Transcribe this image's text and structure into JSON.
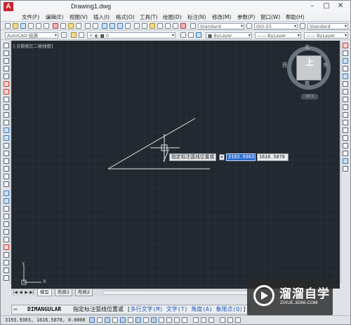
{
  "window": {
    "title": "Drawing1.dwg",
    "logo": "A"
  },
  "window_controls": {
    "minimize": "–",
    "maximize": "□",
    "close": "✕"
  },
  "menu": [
    {
      "label": "文件(F)"
    },
    {
      "label": "编辑(E)"
    },
    {
      "label": "视图(V)"
    },
    {
      "label": "插入(I)"
    },
    {
      "label": "格式(O)"
    },
    {
      "label": "工具(T)"
    },
    {
      "label": "绘图(D)"
    },
    {
      "label": "标注(N)"
    },
    {
      "label": "修改(M)"
    },
    {
      "label": "参数(P)"
    },
    {
      "label": "窗口(W)"
    },
    {
      "label": "帮助(H)"
    }
  ],
  "toolbars": {
    "text_style": "Standard",
    "dim_style": "ISO-25",
    "table_style": "Standard",
    "workspace": "AutoCAD 经典",
    "layer": "0",
    "color": "ByLayer",
    "linetype": "ByLayer",
    "lineweight": "ByLayer"
  },
  "viewport": {
    "label": "[-][俯视][二维线框]",
    "viewcube": {
      "north": "北",
      "south": "南",
      "east": "东",
      "west": "西",
      "face": "上",
      "wcs": "WCS"
    },
    "ucs": {
      "x": "X",
      "y": "Y"
    }
  },
  "dynamic_input": {
    "prompt": "指定标注弧线位置或",
    "x_value": "3193.9303",
    "y_value": "1616.5878",
    "menu_arrow": "▾"
  },
  "layout_tabs": [
    {
      "label": "模型",
      "active": true
    },
    {
      "label": "布局1",
      "active": false
    },
    {
      "label": "布局2",
      "active": false
    }
  ],
  "command_line": {
    "icon": "⌨",
    "command": "DIMANGULAR",
    "prompt": "指定标注弧线位置或 [",
    "options": [
      {
        "text": "多行文字(M)"
      },
      {
        "text": "文字(T)"
      },
      {
        "text": "角度(A)"
      },
      {
        "text": "象限点(Q)"
      }
    ],
    "close": "]:"
  },
  "status_bar": {
    "coordinates": "3193.9303, 1616.5878, 0.0000"
  },
  "watermark": {
    "cn": "溜溜自学",
    "url": "ZIXUE.3D66.COM"
  },
  "colors": {
    "canvas": "#212830",
    "accent": "#2d6fd1",
    "brand": "#c8232c"
  }
}
